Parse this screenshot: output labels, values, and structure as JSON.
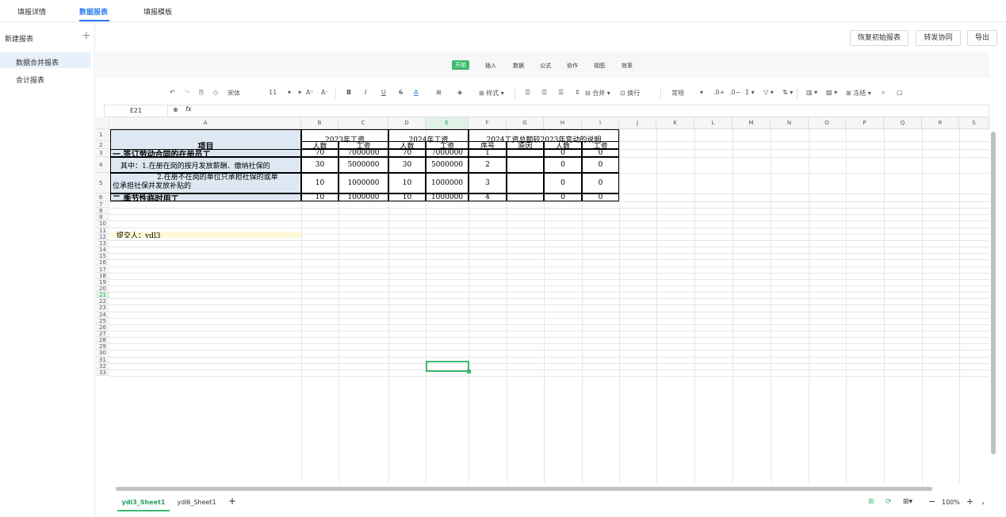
{
  "tabs": [
    "填报详情",
    "数据报表",
    "填报模板"
  ],
  "sidebar": {
    "new_label": "新建报表",
    "add_icon": "+",
    "items": [
      "数据合并报表",
      "合计报表"
    ]
  },
  "actions": {
    "restore": "恢复初始报表",
    "forward": "转发协同",
    "export": "导出"
  },
  "menu": [
    "开始",
    "插入",
    "数据",
    "公式",
    "协作",
    "视图",
    "效率"
  ],
  "toolbar": {
    "font": "宋体",
    "size": "11",
    "style": "样式",
    "merge": "合并",
    "wrap": "换行",
    "format": "常规",
    "freeze": "冻结"
  },
  "formula_bar": {
    "cell_ref": "E21",
    "fx": "fx",
    "value": ""
  },
  "columns": [
    "A",
    "B",
    "C",
    "D",
    "E",
    "F",
    "G",
    "H",
    "I",
    "J",
    "K",
    "L",
    "M",
    "N",
    "O",
    "P",
    "Q",
    "R",
    "S"
  ],
  "rows": [
    "1",
    "2",
    "3",
    "4",
    "5",
    "6",
    "7",
    "8",
    "9",
    "10",
    "11",
    "12",
    "13",
    "14",
    "15",
    "16",
    "17",
    "18",
    "19",
    "20",
    "21",
    "22",
    "23",
    "24",
    "25",
    "26",
    "27",
    "28",
    "29",
    "30",
    "31",
    "32",
    "33"
  ],
  "sheet": {
    "h_item": "项目",
    "h_2023": "2023年工资",
    "h_2024": "2024年工资",
    "h_note": "2024工资总额较2023年变动的说明",
    "sub": [
      "人数",
      "工资",
      "人数",
      "工资",
      "序号",
      "原因",
      "人数",
      "工资"
    ],
    "r3": [
      "一.签订劳动合同的在册员工",
      "70",
      "7000000",
      "70",
      "7000000",
      "1",
      "",
      "0",
      "0"
    ],
    "r4": [
      "其中：1.在册在岗的按月发放薪酬、缴纳社保的",
      "30",
      "5000000",
      "30",
      "5000000",
      "2",
      "",
      "0",
      "0"
    ],
    "r5a": "2.在册不在岗的单位只承担社保的或单",
    "r5b": "位承担社保并发放补贴的",
    "r5": [
      "10",
      "1000000",
      "10",
      "1000000",
      "3",
      "",
      "0",
      "0"
    ],
    "r6": [
      "二.季节性临时用工",
      "10",
      "1000000",
      "10",
      "1000000",
      "4",
      "",
      "0",
      "0"
    ],
    "r7": "提交人：ydl3"
  },
  "sheet_tabs": [
    "ydl3_Sheet1",
    "ydl6_Sheet1"
  ],
  "zoom": "100%"
}
